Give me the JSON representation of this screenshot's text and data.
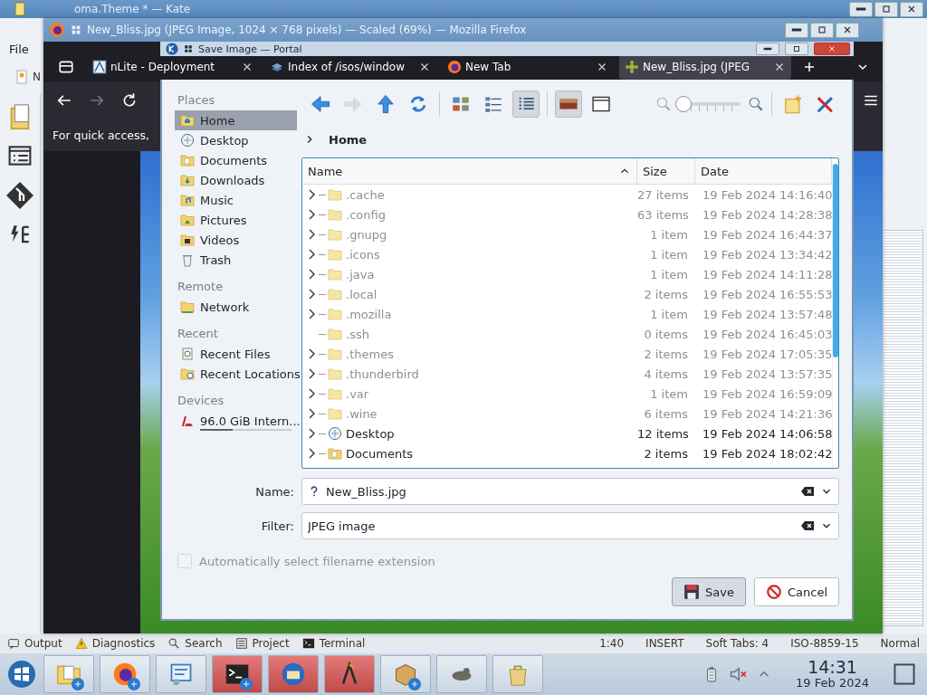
{
  "kate": {
    "title": "oma.Theme * — Kate",
    "menu": [
      "File"
    ],
    "doc_tab": "N",
    "status_tools": [
      {
        "kind": "output",
        "label": "Output"
      },
      {
        "kind": "diagnostics",
        "label": "Diagnostics"
      },
      {
        "kind": "search",
        "label": "Search"
      },
      {
        "kind": "project",
        "label": "Project"
      },
      {
        "kind": "terminal",
        "label": "Terminal"
      }
    ],
    "status_info": [
      "1:40",
      "INSERT",
      "Soft Tabs: 4",
      "ISO-8859-15",
      "Normal"
    ]
  },
  "firefox": {
    "title": "New_Bliss.jpg (JPEG Image, 1024 × 768 pixels) — Scaled (69%) — Mozilla Firefox",
    "tabs": [
      {
        "label": "nLite - Deployment",
        "kind": "nlite",
        "selected": false
      },
      {
        "label": "Index of /isos/window",
        "kind": "index",
        "selected": false
      },
      {
        "label": "New Tab",
        "kind": "firefox",
        "selected": false
      },
      {
        "label": "New_Bliss.jpg (JPEG",
        "kind": "image",
        "selected": true
      }
    ],
    "forward_disabled": true,
    "bookmarks_hint": "For quick access,"
  },
  "dialog": {
    "title": "Save Image — Portal",
    "nav": [
      {
        "kind": "back",
        "disabled": false
      },
      {
        "kind": "forward",
        "disabled": true
      },
      {
        "kind": "up",
        "disabled": false
      },
      {
        "kind": "reload",
        "disabled": false
      }
    ],
    "views": [
      {
        "kind": "icons-view",
        "selected": false
      },
      {
        "kind": "compact-view",
        "selected": false
      },
      {
        "kind": "details-view",
        "selected": true
      }
    ],
    "panels": [
      {
        "kind": "preview",
        "selected": true
      },
      {
        "kind": "panel",
        "selected": false
      }
    ],
    "zoom": {
      "level": 0.0
    },
    "actions": [
      {
        "kind": "new-folder"
      },
      {
        "kind": "settings"
      }
    ],
    "places": [
      {
        "heading": "Places",
        "items": [
          {
            "label": "Home",
            "kind": "home",
            "selected": true
          },
          {
            "label": "Desktop",
            "kind": "desktop",
            "selected": false
          },
          {
            "label": "Documents",
            "kind": "documents",
            "selected": false
          },
          {
            "label": "Downloads",
            "kind": "downloads",
            "selected": false
          },
          {
            "label": "Music",
            "kind": "music",
            "selected": false
          },
          {
            "label": "Pictures",
            "kind": "pictures",
            "selected": false
          },
          {
            "label": "Videos",
            "kind": "videos",
            "selected": false
          },
          {
            "label": "Trash",
            "kind": "trash",
            "selected": false
          }
        ]
      },
      {
        "heading": "Remote",
        "items": [
          {
            "label": "Network",
            "kind": "network",
            "selected": false
          }
        ]
      },
      {
        "heading": "Recent",
        "items": [
          {
            "label": "Recent Files",
            "kind": "recent-files",
            "selected": false
          },
          {
            "label": "Recent Locations",
            "kind": "recent-locations",
            "selected": false
          }
        ]
      },
      {
        "heading": "Devices",
        "items": [
          {
            "label": "96.0 GiB Intern...",
            "kind": "drive",
            "selected": false,
            "level": 0.36
          }
        ]
      }
    ],
    "breadcrumb": "Home",
    "columns": [
      {
        "label": "Name",
        "sorted": true
      },
      {
        "label": "Size",
        "sorted": false
      },
      {
        "label": "Date",
        "sorted": false
      }
    ],
    "rows": [
      {
        "name": ".cache",
        "size": "27 items",
        "date": "19 Feb 2024 14:16:40",
        "kind": "folder",
        "hidden": true,
        "expandable": true
      },
      {
        "name": ".config",
        "size": "63 items",
        "date": "19 Feb 2024 14:28:38",
        "kind": "folder",
        "hidden": true,
        "expandable": true
      },
      {
        "name": ".gnupg",
        "size": "1 item",
        "date": "19 Feb 2024 16:44:37",
        "kind": "folder",
        "hidden": true,
        "expandable": true
      },
      {
        "name": ".icons",
        "size": "1 item",
        "date": "19 Feb 2024 13:34:42",
        "kind": "folder",
        "hidden": true,
        "expandable": true
      },
      {
        "name": ".java",
        "size": "1 item",
        "date": "19 Feb 2024 14:11:28",
        "kind": "folder",
        "hidden": true,
        "expandable": true
      },
      {
        "name": ".local",
        "size": "2 items",
        "date": "19 Feb 2024 16:55:53",
        "kind": "folder",
        "hidden": true,
        "expandable": true
      },
      {
        "name": ".mozilla",
        "size": "1 item",
        "date": "19 Feb 2024 13:57:48",
        "kind": "folder",
        "hidden": true,
        "expandable": true
      },
      {
        "name": ".ssh",
        "size": "0 items",
        "date": "19 Feb 2024 16:45:03",
        "kind": "folder",
        "hidden": true,
        "expandable": false
      },
      {
        "name": ".themes",
        "size": "2 items",
        "date": "19 Feb 2024 17:05:35",
        "kind": "folder",
        "hidden": true,
        "expandable": true
      },
      {
        "name": ".thunderbird",
        "size": "4 items",
        "date": "19 Feb 2024 13:57:35",
        "kind": "folder",
        "hidden": true,
        "expandable": true
      },
      {
        "name": ".var",
        "size": "1 item",
        "date": "19 Feb 2024 16:59:09",
        "kind": "folder",
        "hidden": true,
        "expandable": true
      },
      {
        "name": ".wine",
        "size": "6 items",
        "date": "19 Feb 2024 14:21:36",
        "kind": "folder",
        "hidden": true,
        "expandable": true
      },
      {
        "name": "Desktop",
        "size": "12 items",
        "date": "19 Feb 2024 14:06:58",
        "kind": "desktop",
        "hidden": false,
        "expandable": true
      },
      {
        "name": "Documents",
        "size": "2 items",
        "date": "19 Feb 2024 18:02:42",
        "kind": "documents",
        "hidden": false,
        "expandable": true
      }
    ],
    "name_field": {
      "label": "Name:",
      "value": "New_Bliss.jpg"
    },
    "filter_field": {
      "label": "Filter:",
      "value": "JPEG image"
    },
    "auto_extension": {
      "label": "Automatically select filename extension",
      "checked": false,
      "disabled": true
    },
    "buttons": [
      {
        "kind": "save",
        "label": "Save",
        "default": true
      },
      {
        "kind": "cancel",
        "label": "Cancel",
        "default": false
      }
    ]
  },
  "taskbar": {
    "apps": [
      {
        "kind": "file-manager",
        "badge": true
      },
      {
        "kind": "firefox",
        "badge": true
      },
      {
        "kind": "settings",
        "badge": false
      },
      {
        "kind": "terminal",
        "badge": true
      },
      {
        "kind": "thunderbird",
        "badge": false
      },
      {
        "kind": "kate",
        "badge": false
      },
      {
        "kind": "package",
        "badge": true
      },
      {
        "kind": "gimp",
        "badge": false
      },
      {
        "kind": "bag",
        "badge": false
      }
    ],
    "volume_muted": true,
    "time": "14:31",
    "date": "19 Feb 2024"
  }
}
